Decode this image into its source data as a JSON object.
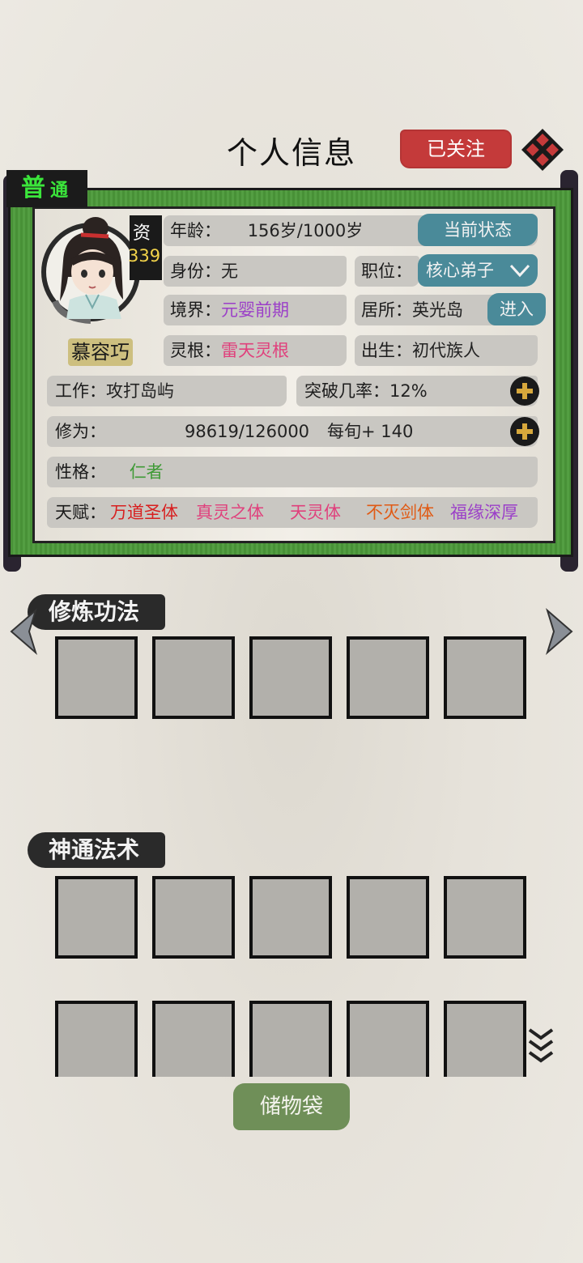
{
  "header": {
    "title": "个人信息",
    "follow_label": "已关注"
  },
  "character": {
    "rank_primary": "普",
    "rank_secondary": "通",
    "aptitude_label": "资",
    "aptitude_value": "339",
    "name": "慕容巧"
  },
  "info": {
    "age_label": "年龄：",
    "age_value": "156岁/1000岁",
    "status_button": "当前状态",
    "identity_label": "身份：",
    "identity_value": "无",
    "position_label": "职位：",
    "position_value": "核心弟子",
    "realm_label": "境界：",
    "realm_value": "元婴前期",
    "residence_label": "居所：",
    "residence_value": "英光岛",
    "enter_button": "进入",
    "root_label": "灵根：",
    "root_value": "雷天灵根",
    "birth_label": "出生：",
    "birth_value": "初代族人",
    "work_label": "工作：",
    "work_value": "攻打岛屿",
    "breakthrough_label": "突破几率：",
    "breakthrough_value": "12%",
    "cultivation_label": "修为：",
    "cultivation_value": "98619/126000",
    "cultivation_rate": "每旬+ 140",
    "personality_label": "性格：",
    "personality_value": "仁者",
    "talent_label": "天赋：",
    "talents": [
      "万道圣体",
      "真灵之体",
      "天灵体",
      "不灭剑体",
      "福缘深厚"
    ]
  },
  "colors": {
    "realm": "#9b3fc8",
    "root": "#e0407c",
    "personality": "#3f9a36",
    "talents": [
      "#d81f1f",
      "#e0407c",
      "#e0407c",
      "#e05a14",
      "#9b3fc8"
    ],
    "rank": "#3be63b",
    "aptitude": "#f2d34a"
  },
  "sections": {
    "techniques_title": "修炼功法",
    "spells_title": "神通法术"
  },
  "bag_button": "储物袋"
}
